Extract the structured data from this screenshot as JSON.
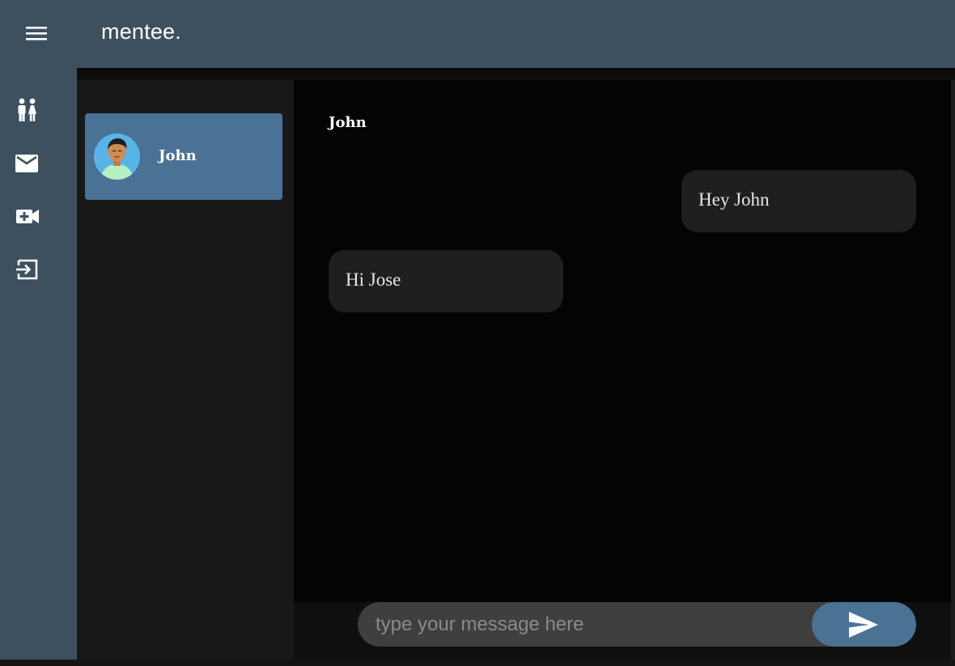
{
  "header": {
    "menu_icon": "menu-icon",
    "brand": "mentee."
  },
  "sidebar": {
    "items": [
      {
        "icon": "people-icon"
      },
      {
        "icon": "mail-icon"
      },
      {
        "icon": "video-call-add-icon"
      },
      {
        "icon": "logout-icon"
      }
    ]
  },
  "contacts": [
    {
      "name": "John",
      "avatar": "avatar-illustration",
      "selected": true
    }
  ],
  "chat": {
    "title": "John",
    "messages": [
      {
        "direction": "sent",
        "text": "Hey John"
      },
      {
        "direction": "received",
        "text": "Hi Jose"
      }
    ]
  },
  "composer": {
    "placeholder": "type your message here",
    "value": "",
    "send_icon": "send-icon"
  },
  "colors": {
    "topbar": "#3d5060",
    "sidebar": "#3d5060",
    "accent": "#4a7294",
    "chat_bg": "#040404",
    "contacts_bg": "#181818",
    "bubble": "#1f1f1f"
  }
}
